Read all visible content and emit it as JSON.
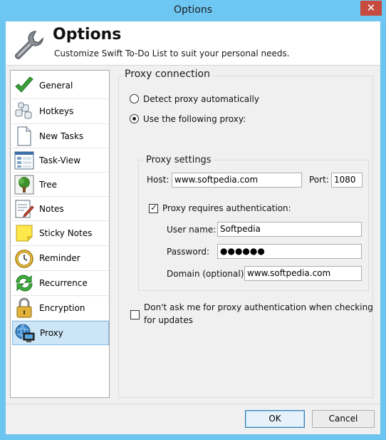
{
  "window": {
    "title": "Options",
    "close_glyph": "✕"
  },
  "header": {
    "icon": "wrench-icon",
    "title": "Options",
    "subtitle": "Customize Swift To-Do List to suit your personal needs."
  },
  "sidebar": {
    "items": [
      {
        "label": "General",
        "icon": "checkmark-icon"
      },
      {
        "label": "Hotkeys",
        "icon": "keyboard-icon"
      },
      {
        "label": "New Tasks",
        "icon": "new-document-icon"
      },
      {
        "label": "Task-View",
        "icon": "task-view-icon"
      },
      {
        "label": "Tree",
        "icon": "tree-icon"
      },
      {
        "label": "Notes",
        "icon": "notes-icon"
      },
      {
        "label": "Sticky Notes",
        "icon": "sticky-note-icon"
      },
      {
        "label": "Reminder",
        "icon": "alarm-clock-icon"
      },
      {
        "label": "Recurrence",
        "icon": "recurrence-icon"
      },
      {
        "label": "Encryption",
        "icon": "padlock-icon"
      },
      {
        "label": "Proxy",
        "icon": "network-computer-icon",
        "selected": true
      }
    ]
  },
  "proxy": {
    "group_title": "Proxy connection",
    "detect_label": "Detect proxy automatically",
    "use_label": "Use the following proxy:",
    "selected_option": "use",
    "settings_title": "Proxy settings",
    "host_label": "Host:",
    "host_value": "www.softpedia.com",
    "port_label": "Port:",
    "port_value": "1080",
    "auth_label": "Proxy requires authentication:",
    "auth_checked": true,
    "username_label": "User name:",
    "username_value": "Softpedia",
    "password_label": "Password:",
    "password_value": "●●●●●●",
    "domain_label": "Domain (optional):",
    "domain_value": "www.softpedia.com",
    "dont_ask_label_line1": "Don't ask me for proxy authentication when checking",
    "dont_ask_label_line2": "for updates",
    "dont_ask_checked": false
  },
  "buttons": {
    "ok": "OK",
    "cancel": "Cancel"
  },
  "colors": {
    "titlebar": "#6ec6f2",
    "close": "#c74a3f",
    "selected_bg": "#cde6f7",
    "selected_border": "#84bde6"
  }
}
